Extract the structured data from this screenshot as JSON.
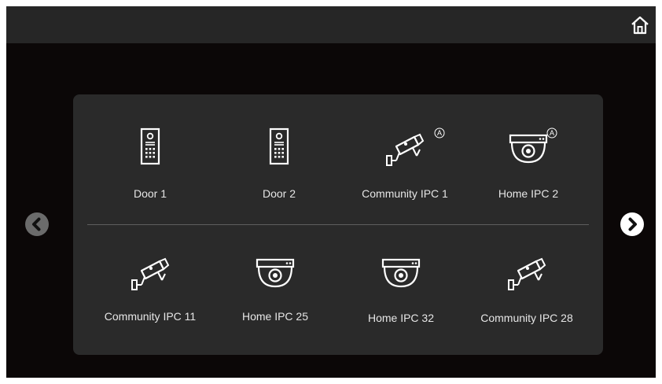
{
  "header": {
    "home_icon": "home-icon"
  },
  "navigation": {
    "prev_icon": "chevron-left-icon",
    "next_icon": "chevron-right-icon"
  },
  "devices_row1": [
    {
      "label": "Door 1",
      "icon": "door-intercom-icon"
    },
    {
      "label": "Door 2",
      "icon": "door-intercom-icon"
    },
    {
      "label": "Community IPC 1",
      "icon": "bullet-camera-icon",
      "badge": "A"
    },
    {
      "label": "Home IPC 2",
      "icon": "dome-camera-icon",
      "badge": "A"
    }
  ],
  "devices_row2": [
    {
      "label": "Community IPC 11",
      "icon": "bullet-camera-icon"
    },
    {
      "label": "Home IPC 25",
      "icon": "dome-camera-icon"
    },
    {
      "label": "Home IPC 32",
      "icon": "dome-camera-icon"
    },
    {
      "label": "Community IPC 28",
      "icon": "bullet-camera-icon"
    }
  ],
  "colors": {
    "background": "#0b0707",
    "topbar": "#262626",
    "panel": "#2a2a2a",
    "text": "#e6e6e6"
  }
}
